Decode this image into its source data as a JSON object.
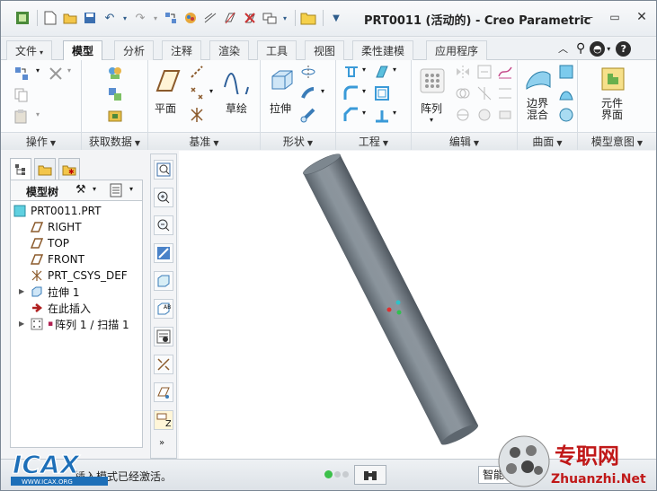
{
  "window": {
    "title": "PRT0011 (活动的) - Creo Parametric"
  },
  "tabs": [
    {
      "label": "文件",
      "has_dropdown": true
    },
    {
      "label": "模型",
      "active": true
    },
    {
      "label": "分析"
    },
    {
      "label": "注释"
    },
    {
      "label": "渲染"
    },
    {
      "label": "工具"
    },
    {
      "label": "视图"
    },
    {
      "label": "柔性建模"
    },
    {
      "label": "应用程序"
    }
  ],
  "ribbon": {
    "groups": [
      {
        "label": "操作"
      },
      {
        "label": "获取数据"
      },
      {
        "label": "基准",
        "buttons": [
          "平面",
          "草绘"
        ]
      },
      {
        "label": "形状",
        "buttons": [
          "拉伸"
        ]
      },
      {
        "label": "工程"
      },
      {
        "label": "编辑",
        "buttons": [
          "阵列"
        ]
      },
      {
        "label": "曲面",
        "buttons": [
          "边界\n混合"
        ]
      },
      {
        "label": "模型意图",
        "buttons": [
          "元件\n界面"
        ]
      }
    ]
  },
  "model_tree": {
    "header": "模型树",
    "items": [
      {
        "label": "PRT0011.PRT",
        "icon": "part-icon"
      },
      {
        "label": "RIGHT",
        "icon": "datum-plane-icon"
      },
      {
        "label": "TOP",
        "icon": "datum-plane-icon"
      },
      {
        "label": "FRONT",
        "icon": "datum-plane-icon"
      },
      {
        "label": "PRT_CSYS_DEF",
        "icon": "csys-icon"
      },
      {
        "label": "拉伸 1",
        "icon": "extrude-icon",
        "expandable": true
      },
      {
        "label": "在此插入",
        "icon": "insert-here-icon"
      },
      {
        "label": "阵列 1 / 扫描 1",
        "icon": "pattern-icon",
        "expandable": true
      }
    ]
  },
  "status_bar": {
    "message": "插入模式已经激活。",
    "smart_filter": "智能"
  },
  "watermark": {
    "left_logo": "ICAX",
    "left_logo_url": "WWW.ICAX.ORG",
    "right_brand": "专职网",
    "right_url": "Zhuanzhi.Net"
  },
  "colors": {
    "accent": "#2f6ea8",
    "cylinder": "#7e8891",
    "canvas": "#ffffff"
  }
}
